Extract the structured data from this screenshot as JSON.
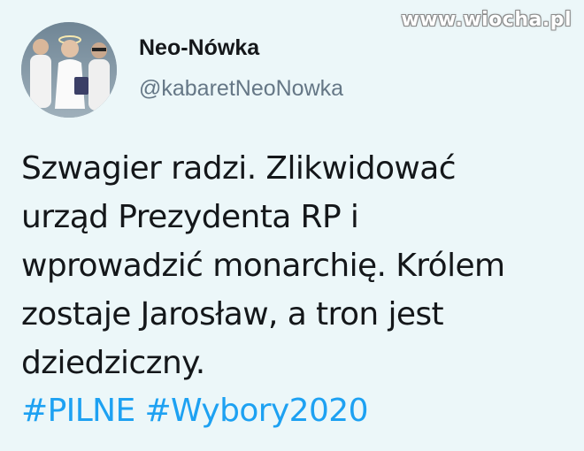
{
  "watermark": "www.wiocha.pl",
  "author": {
    "display_name": "Neo-Nówka",
    "handle": "@kabaretNeoNowka"
  },
  "tweet": {
    "lines": [
      "Szwagier radzi. Zlikwidować",
      "urząd Prezydenta RP i",
      "wprowadzić monarchię. Królem",
      "zostaje Jarosław, a tron jest",
      "dziedziczny."
    ],
    "hashtags": [
      "#PILNE",
      "#Wybory2020"
    ]
  },
  "colors": {
    "background": "#ecf7f9",
    "text": "#14171a",
    "handle": "#657786",
    "hashtag": "#1da1f2"
  }
}
